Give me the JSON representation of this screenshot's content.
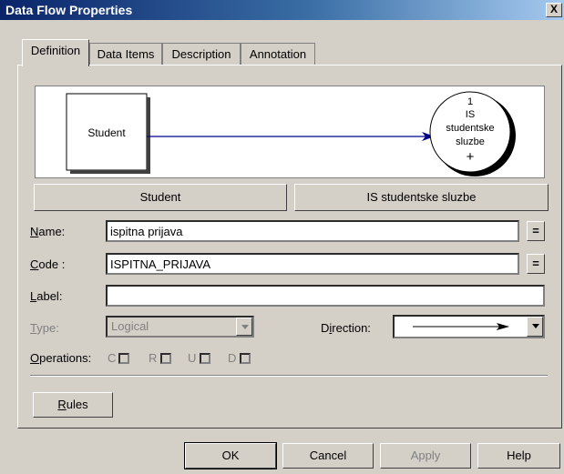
{
  "window": {
    "title": "Data Flow Properties",
    "close_label": "X"
  },
  "tabs": [
    {
      "label": "Definition",
      "active": true
    },
    {
      "label": "Data Items"
    },
    {
      "label": "Description"
    },
    {
      "label": "Annotation"
    }
  ],
  "diagram": {
    "source_label": "Student",
    "process_number": "1",
    "process_line1": "IS",
    "process_line2": "studentske",
    "process_line3": "sluzbe",
    "process_plus": "+"
  },
  "object_buttons": {
    "source": "Student",
    "target": "IS studentske sluzbe"
  },
  "form": {
    "name_label_u": "N",
    "name_label_rest": "ame:",
    "name_value": "ispitna prijava",
    "code_label_u": "C",
    "code_label_rest": "ode :",
    "code_value": "ISPITNA_PRIJAVA",
    "label_label_u": "L",
    "label_label_rest": "abel:",
    "label_value": "",
    "type_label_u": "T",
    "type_label_rest": "ype:",
    "type_value": "Logical",
    "direction_label_pre": "D",
    "direction_label_u": "i",
    "direction_label_rest": "rection:",
    "operations_label_u": "O",
    "operations_label_rest": "perations:",
    "ops": [
      "C",
      "R",
      "U",
      "D"
    ],
    "eq_label": "="
  },
  "rules_button": {
    "label_u": "R",
    "label_rest": "ules"
  },
  "footer": {
    "ok": "OK",
    "cancel": "Cancel",
    "apply": "Apply",
    "help": "Help"
  }
}
